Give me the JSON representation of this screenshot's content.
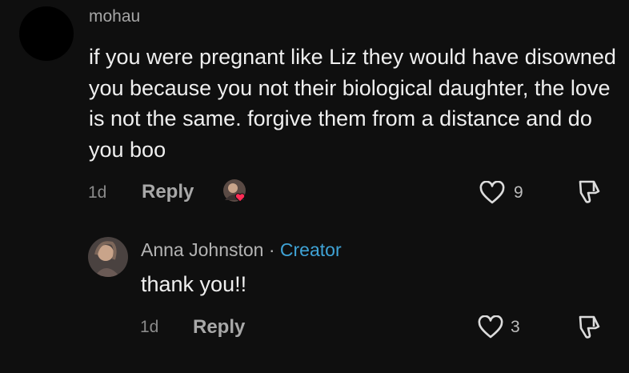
{
  "comment": {
    "username": "mohau",
    "text": "if you were pregnant like Liz they would have disowned you because you not their biological daughter, the love is not the same. forgive them from a distance and do you boo",
    "time": "1d",
    "reply_label": "Reply",
    "like_count": "9",
    "icons": {
      "like": "heart-outline-icon",
      "dislike": "thumbs-down-icon",
      "liked_by": "creator-liked-avatar"
    }
  },
  "reply": {
    "author": "Anna Johnston",
    "separator": " · ",
    "badge": "Creator",
    "text": "thank you!!",
    "time": "1d",
    "reply_label": "Reply",
    "like_count": "3"
  },
  "colors": {
    "background": "#0f0f0f",
    "creator_badge": "#3fa3d6",
    "heart": "#fe2c55"
  }
}
